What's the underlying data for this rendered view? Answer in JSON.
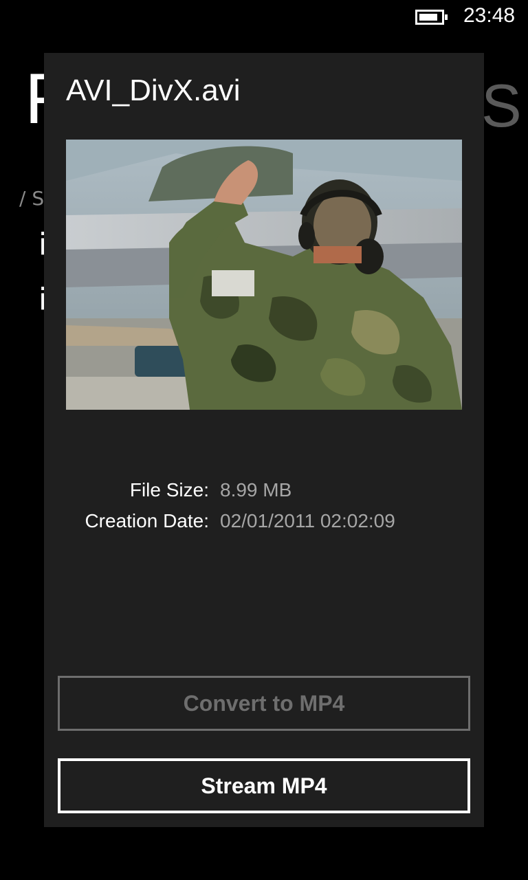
{
  "status_bar": {
    "time": "23:48",
    "battery_level": 0.85
  },
  "background_page": {
    "title_left": "F",
    "title_right": "S",
    "path": "/ S",
    "items": [
      "i",
      "i"
    ]
  },
  "dialog": {
    "title": "AVI_DivX.avi",
    "preview_icon": "video-thumbnail",
    "info": [
      {
        "label": "File Size:",
        "value": "8.99 MB"
      },
      {
        "label": "Creation Date:",
        "value": "02/01/2011 02:02:09"
      }
    ],
    "convert_button": "Convert to MP4",
    "stream_button": "Stream MP4"
  },
  "colors": {
    "dialog_background": "#1f1f1f",
    "disabled_text": "#6e6e6e",
    "value_text": "#a6a6a6"
  }
}
